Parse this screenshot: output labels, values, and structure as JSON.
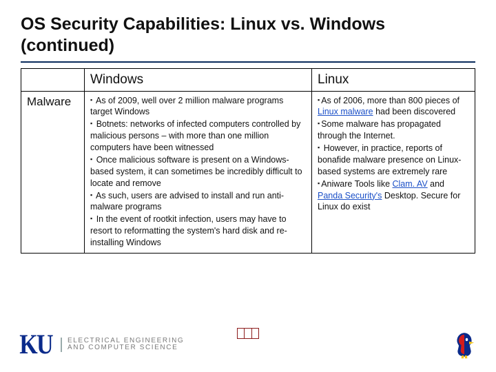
{
  "title": "OS Security Capabilities: Linux vs. Windows (continued)",
  "table": {
    "headers": {
      "blank": "",
      "windows": "Windows",
      "linux": "Linux"
    },
    "row_label": "Malware",
    "windows_bullets": [
      "As of 2009, well over 2 million malware programs target Windows",
      "Botnets: networks of infected computers controlled by malicious persons – with more than one million computers have been witnessed",
      "Once malicious software is present on a Windows-based system, it can sometimes be incredibly difficult to locate and remove",
      "As such, users are advised to install and run anti-malware programs",
      "In the event of rootkit infection, users may have to resort to reformatting the system's hard disk and re-installing Windows"
    ],
    "linux_bullets_pre": "As of 2006, more than 800 pieces of ",
    "linux_link1": "Linux malware",
    "linux_bullets_post1": " had been discovered",
    "linux_b2": "Some malware has propagated through the Internet.",
    "linux_b3": "However, in practice, reports of bonafide malware presence on Linux-based systems are extremely rare",
    "linux_b4_pre": "Aniware Tools like ",
    "linux_link2": "Clam. AV",
    "linux_b4_mid": " and ",
    "linux_link3": "Panda Security's",
    "linux_b4_post": " Desktop. Secure for Linux do exist"
  },
  "footer": {
    "logo_mark": "KU",
    "logo_line1": "ELECTRICAL ENGINEERING",
    "logo_line2": "AND COMPUTER SCIENCE"
  }
}
